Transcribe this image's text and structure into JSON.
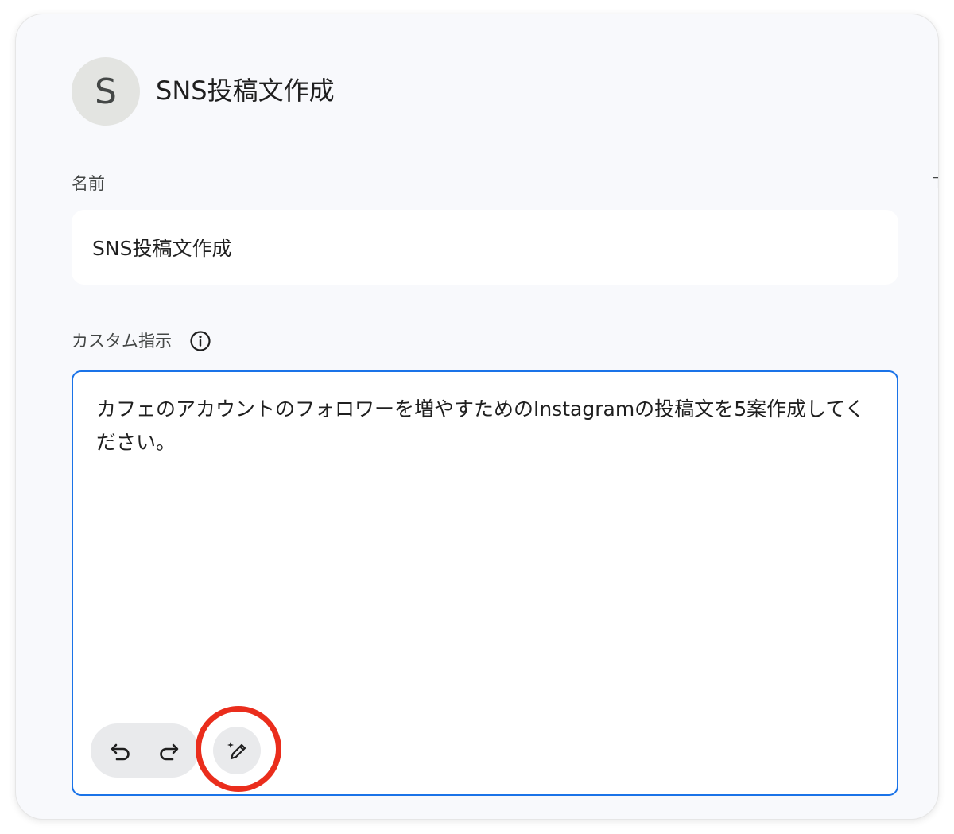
{
  "gem": {
    "avatar_letter": "S",
    "title": "SNS投稿文作成"
  },
  "form": {
    "name_label": "名前",
    "name_value": "SNS投稿文作成",
    "instructions_label": "カスタム指示",
    "instructions_value": "カフェのアカウントのフォロワーを増やすためのInstagramの投稿文を5案作成してください。"
  },
  "toolbar": {
    "icons": [
      "undo-icon",
      "redo-icon",
      "magic-edit-icon"
    ]
  },
  "colors": {
    "focus_border": "#1a73e8",
    "highlight_ring": "#ea2d1c",
    "panel_bg": "#f8f9fc"
  }
}
